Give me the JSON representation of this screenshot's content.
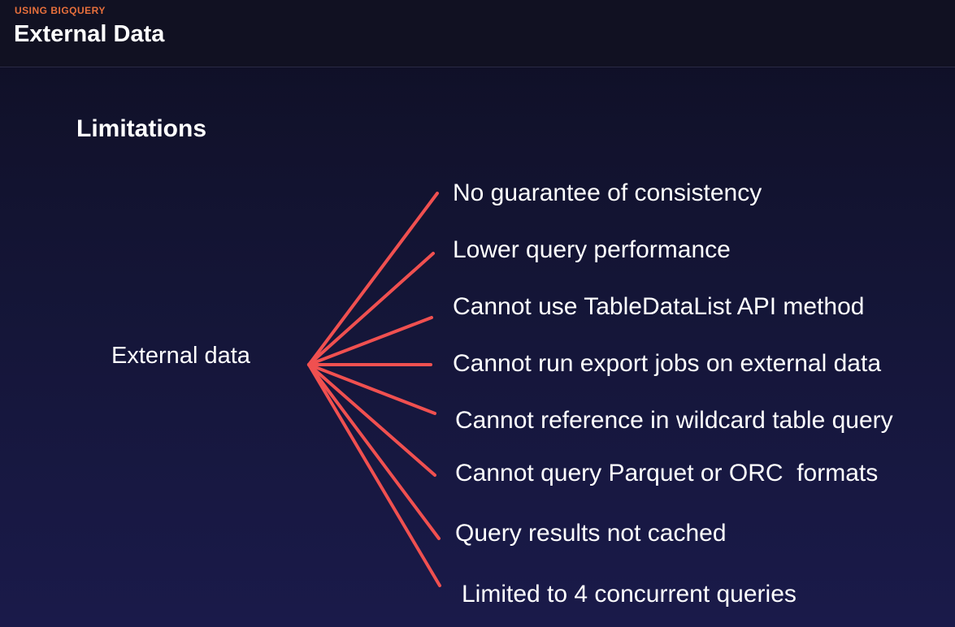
{
  "header": {
    "kicker": "USING BIGQUERY",
    "title": "External Data"
  },
  "slide": {
    "subtitle": "Limitations",
    "hub_label": "External data",
    "line_color": "#f05050",
    "limitations": [
      "No guarantee of consistency",
      "Lower query performance",
      "Cannot use TableDataList API method",
      "Cannot run export jobs on external data",
      "Cannot reference in wildcard table query",
      "Cannot query Parquet or ORC  formats",
      "Query results not cached",
      "Limited to 4 concurrent queries"
    ]
  }
}
